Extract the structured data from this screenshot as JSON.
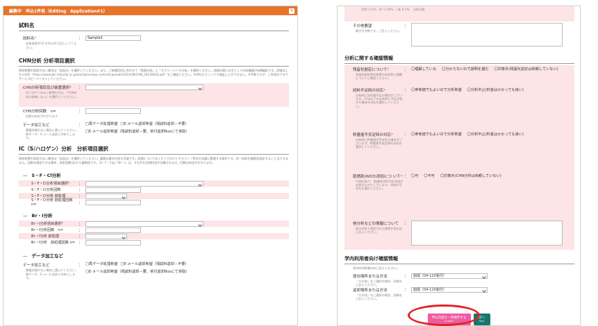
{
  "left": {
    "header_title": "編集中　申込1件目（Editing　Application#1）",
    "sample_section": {
      "title": "試料名",
      "label": "試料名",
      "required_mark": "*",
      "sub": "半角英数字10 文字以内で記入してください。",
      "value": "Sample1"
    },
    "chn_section": {
      "title": "CHN分析 分析項目選択",
      "desc": "原則装置の指定がない場合は「自由分」を選択してください。また、ご依頼目的に合わせて「極限分析」と「スクリーニング分析」を選択ください。詳細の違いは主として分析機器(外部機器)です。詳細はこちらURL（https://www.gfc.hokudai.ac.jp/wordpress/wp-content/uploads/2023/08/CHN_20230803.pdf）をご確認ください。※URLからリンクで検出ことができない。※手数ですが、ご利用のブラウザーにコピーペーストしてください。",
      "items_label": "CHN分析項目及び装置選択",
      "items_required": "*",
      "items_sub": "S/ハロゲンのみご希望の方は、「CHN分析は依頼しない」を選択してください。",
      "count_label": "CHN分析回数　n=",
      "count_sub": "回数分料金がかかります",
      "processing_label": "データ加工など",
      "processing_sub": "需要詳細がない場合に選んでください。異データ：E-メール送部と共有とします。",
      "options": [
        "□再データ処理希望",
        "□E-メール返却希望（残試料返却－不要）",
        "□E-メール返却希望（残試料返却－要、受付返却Boxにて受取）"
      ]
    },
    "ic_section": {
      "title": "IC（S/ハロゲン）分析　分析項目選択",
      "desc": "原則装置の指定がない場合は「自由分」を選択してください。複数元素の分析も可能です。詳細についてはイオンクロマトグラフィー等の方法論に関連する操作です。同一試料を複数回測定することはできません。回数を指定できる場合、測定回数は1から複数回です。（S・F・Clは「Br・I」は、それぞれ別途料金が計算されます。回数分料金がかかります。",
      "sfcl": {
        "heading": "S・F・Cl分析",
        "rows": [
          "S・F・Cl分析項目選択",
          "S・F・Cl分析回数",
          "S・F・Cl分析 前処理",
          "S・F・Cl分析 前処理回数 n="
        ]
      },
      "br": {
        "heading": "Br・I分析",
        "rows": [
          "Br・I分析項目選択",
          "Br・I分析回数　n=",
          "Br・I分析 前処理",
          "Br・I分析　前処理回数 n="
        ]
      },
      "data_proc": {
        "heading": "データ加工など",
        "label": "データ加工など",
        "sub": "需要詳細がない場合に選んでください。異データ：E-メール送部と共有とします。",
        "options": [
          "□再データ処理希望",
          "□E-メール返却希望（残試料返却－不要）",
          "□E-メール返却希望（残試料返却－要、受付返却Boxにて受取）"
        ]
      }
    },
    "colon": "："
  },
  "right": {
    "top_snippet": "目的: 0.1%、Br: 1.00%、I 新 0.1%、 分析可能",
    "other_label": "その他要望",
    "other_sub": "最大文字数です。ご記入ください。",
    "confirm_title": "分析に関する確認情報",
    "confirm_rows": [
      {
        "label": "残留化割定について",
        "sub": "残留化割定時の結果の有効性と理解についてご確認ください。",
        "options": [
          "〇理解している",
          "〇分からないので説明を望む",
          "〇対象外(残留化割定は依頼していない)"
        ]
      },
      {
        "label": "試料不足時の対応",
        "sub": "分析時に試料量不足の場合がございます。1mg以下の分析時に不足が起きた場合の対応を選択してください。",
        "options": [
          "〇参考値でもよいので分析希望",
          "〇分析中止(料金はかかっても良い)"
        ]
      },
      {
        "label": "秤量値不安定時の対応",
        "sub": "分析時に秤量値が不安定な場合がございます。秤量値不安定時の対応を選択してください。",
        "options": [
          "〇参考値でもよいので分析希望",
          "〇分析中止(料金はかかっても良い)"
        ]
      },
      {
        "label": "助燃剤(WO3)添加につ いて",
        "sub": "CHN分析で、助燃剤(WO3)の添加が必要なものもございます。添加の可否をお選びください。",
        "options": [
          "〇可",
          "〇不可",
          "〇対象外(CHN分析は依頼していない)"
        ]
      },
      {
        "label": "他分析などの情報について",
        "sub": "他の分析で測定された値等があればご記入ください。",
        "options": []
      }
    ],
    "campus_title": "学内利用者向け確認情報",
    "campus_desc": "学内の利用者のみご記入ください。",
    "campus_rows": [
      {
        "label": "提出場所または方法",
        "sub": "「その他」をご選択の場合、詳細をご記入ください。",
        "value": "創成（04-110受付）"
      },
      {
        "label": "返却場所または方法",
        "sub": "「その他」をご選択の場合、詳細をご記入ください。",
        "value": "創成（04-110受付）"
      }
    ],
    "btn_submit": "申込内容を一時保存する",
    "btn_submit_sub": "Submit",
    "btn_next": "次へ",
    "btn_next_sub": "Next",
    "colon": "："
  }
}
